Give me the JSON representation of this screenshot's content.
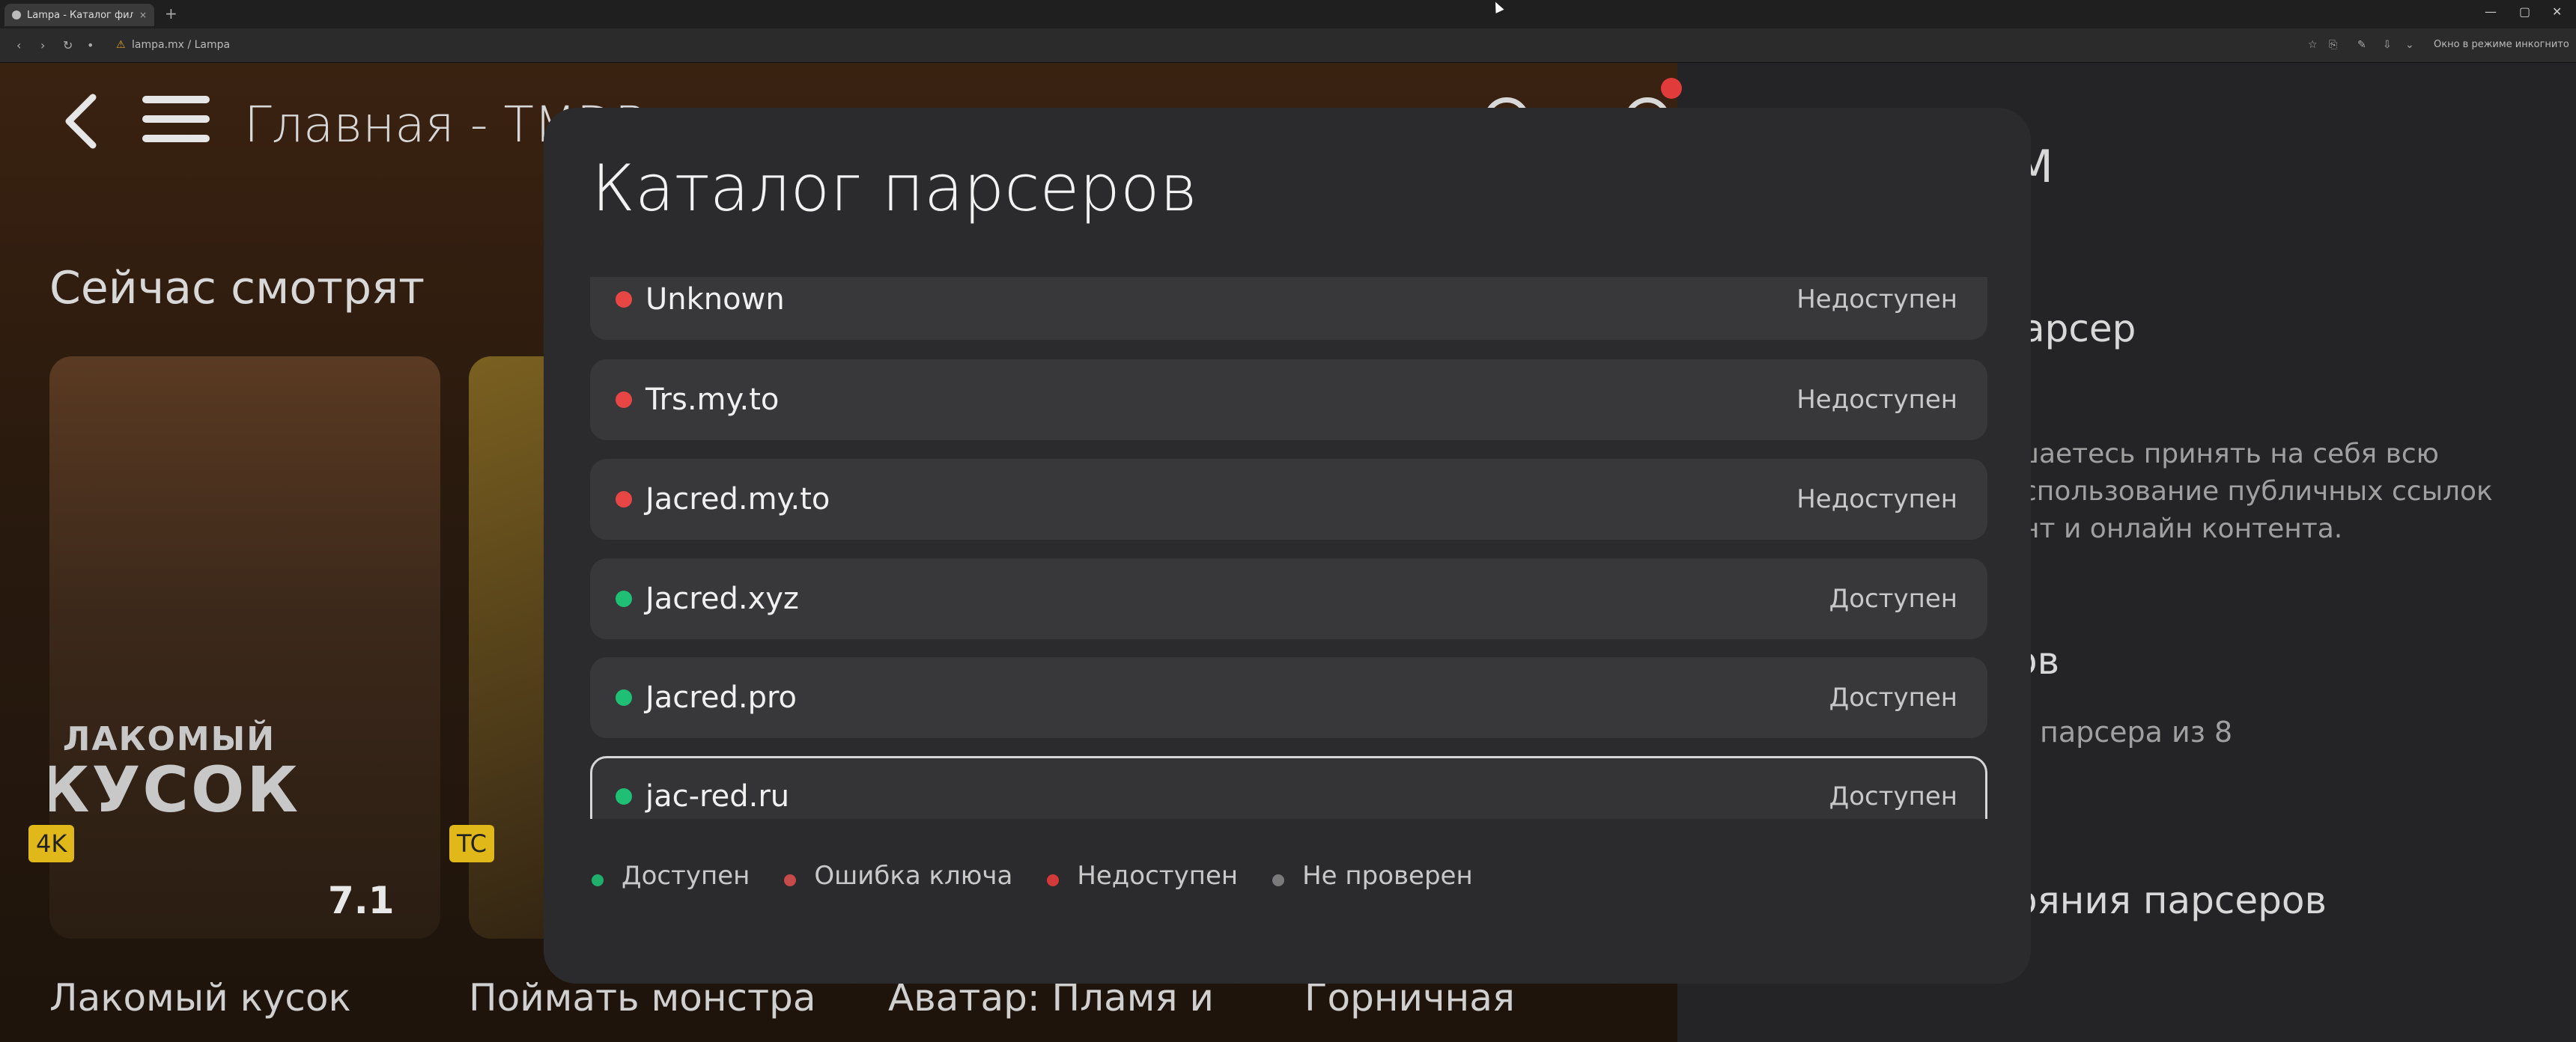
{
  "browser": {
    "tab_title": "Lampa - Каталог фильмов и",
    "tab_close": "×",
    "new_tab": "+",
    "url": "lampa.mx / Lampa",
    "incognito_label": "Окно в режиме инкогнито",
    "window_controls": [
      "—",
      "▢",
      "✕"
    ]
  },
  "header": {
    "title": "Главная - TMDB"
  },
  "section": {
    "title": "Сейчас смотрят"
  },
  "cards": [
    {
      "poster_line1": "ЛАКОМЫЙ",
      "poster_line2": "КУСОК",
      "quality": "4K",
      "rating": "7.1",
      "title": "Лакомый кусок"
    },
    {
      "quality": "TC",
      "title": "Поймать монстра"
    }
  ],
  "more_titles": [
    "Аватар: Пламя и",
    "Горничная"
  ],
  "right_panel": {
    "heading_fragment": "М",
    "parser_fragment": "арсер",
    "disclaimer_lines": [
      "шаетесь принять на себя всю",
      "спользование публичных ссылок",
      "нт и онлайн контента."
    ],
    "parsers_fragment": "ов",
    "count_fragment": "парсера из 8",
    "status_fragment": "ояния парсеров"
  },
  "modal": {
    "title": "Каталог парсеров",
    "rows": [
      {
        "name": "Unknown",
        "status": "Недоступен",
        "state": "unavailable"
      },
      {
        "name": "Trs.my.to",
        "status": "Недоступен",
        "state": "unavailable"
      },
      {
        "name": "Jacred.my.to",
        "status": "Недоступен",
        "state": "unavailable"
      },
      {
        "name": "Jacred.xyz",
        "status": "Доступен",
        "state": "available"
      },
      {
        "name": "Jacred.pro",
        "status": "Доступен",
        "state": "available"
      },
      {
        "name": "jac-red.ru",
        "status": "Доступен",
        "state": "available",
        "selected": true
      }
    ],
    "legend": [
      {
        "label": "Доступен",
        "color": "#1fae6b"
      },
      {
        "label": "Ошибка ключа",
        "color": "#c94a4a"
      },
      {
        "label": "Недоступен",
        "color": "#d43a3a"
      },
      {
        "label": "Не проверен",
        "color": "#7a7a7a"
      }
    ]
  },
  "colors": {
    "available": "#1fbf75",
    "unavailable": "#e84545",
    "quality_badge": "#e0b81a"
  }
}
